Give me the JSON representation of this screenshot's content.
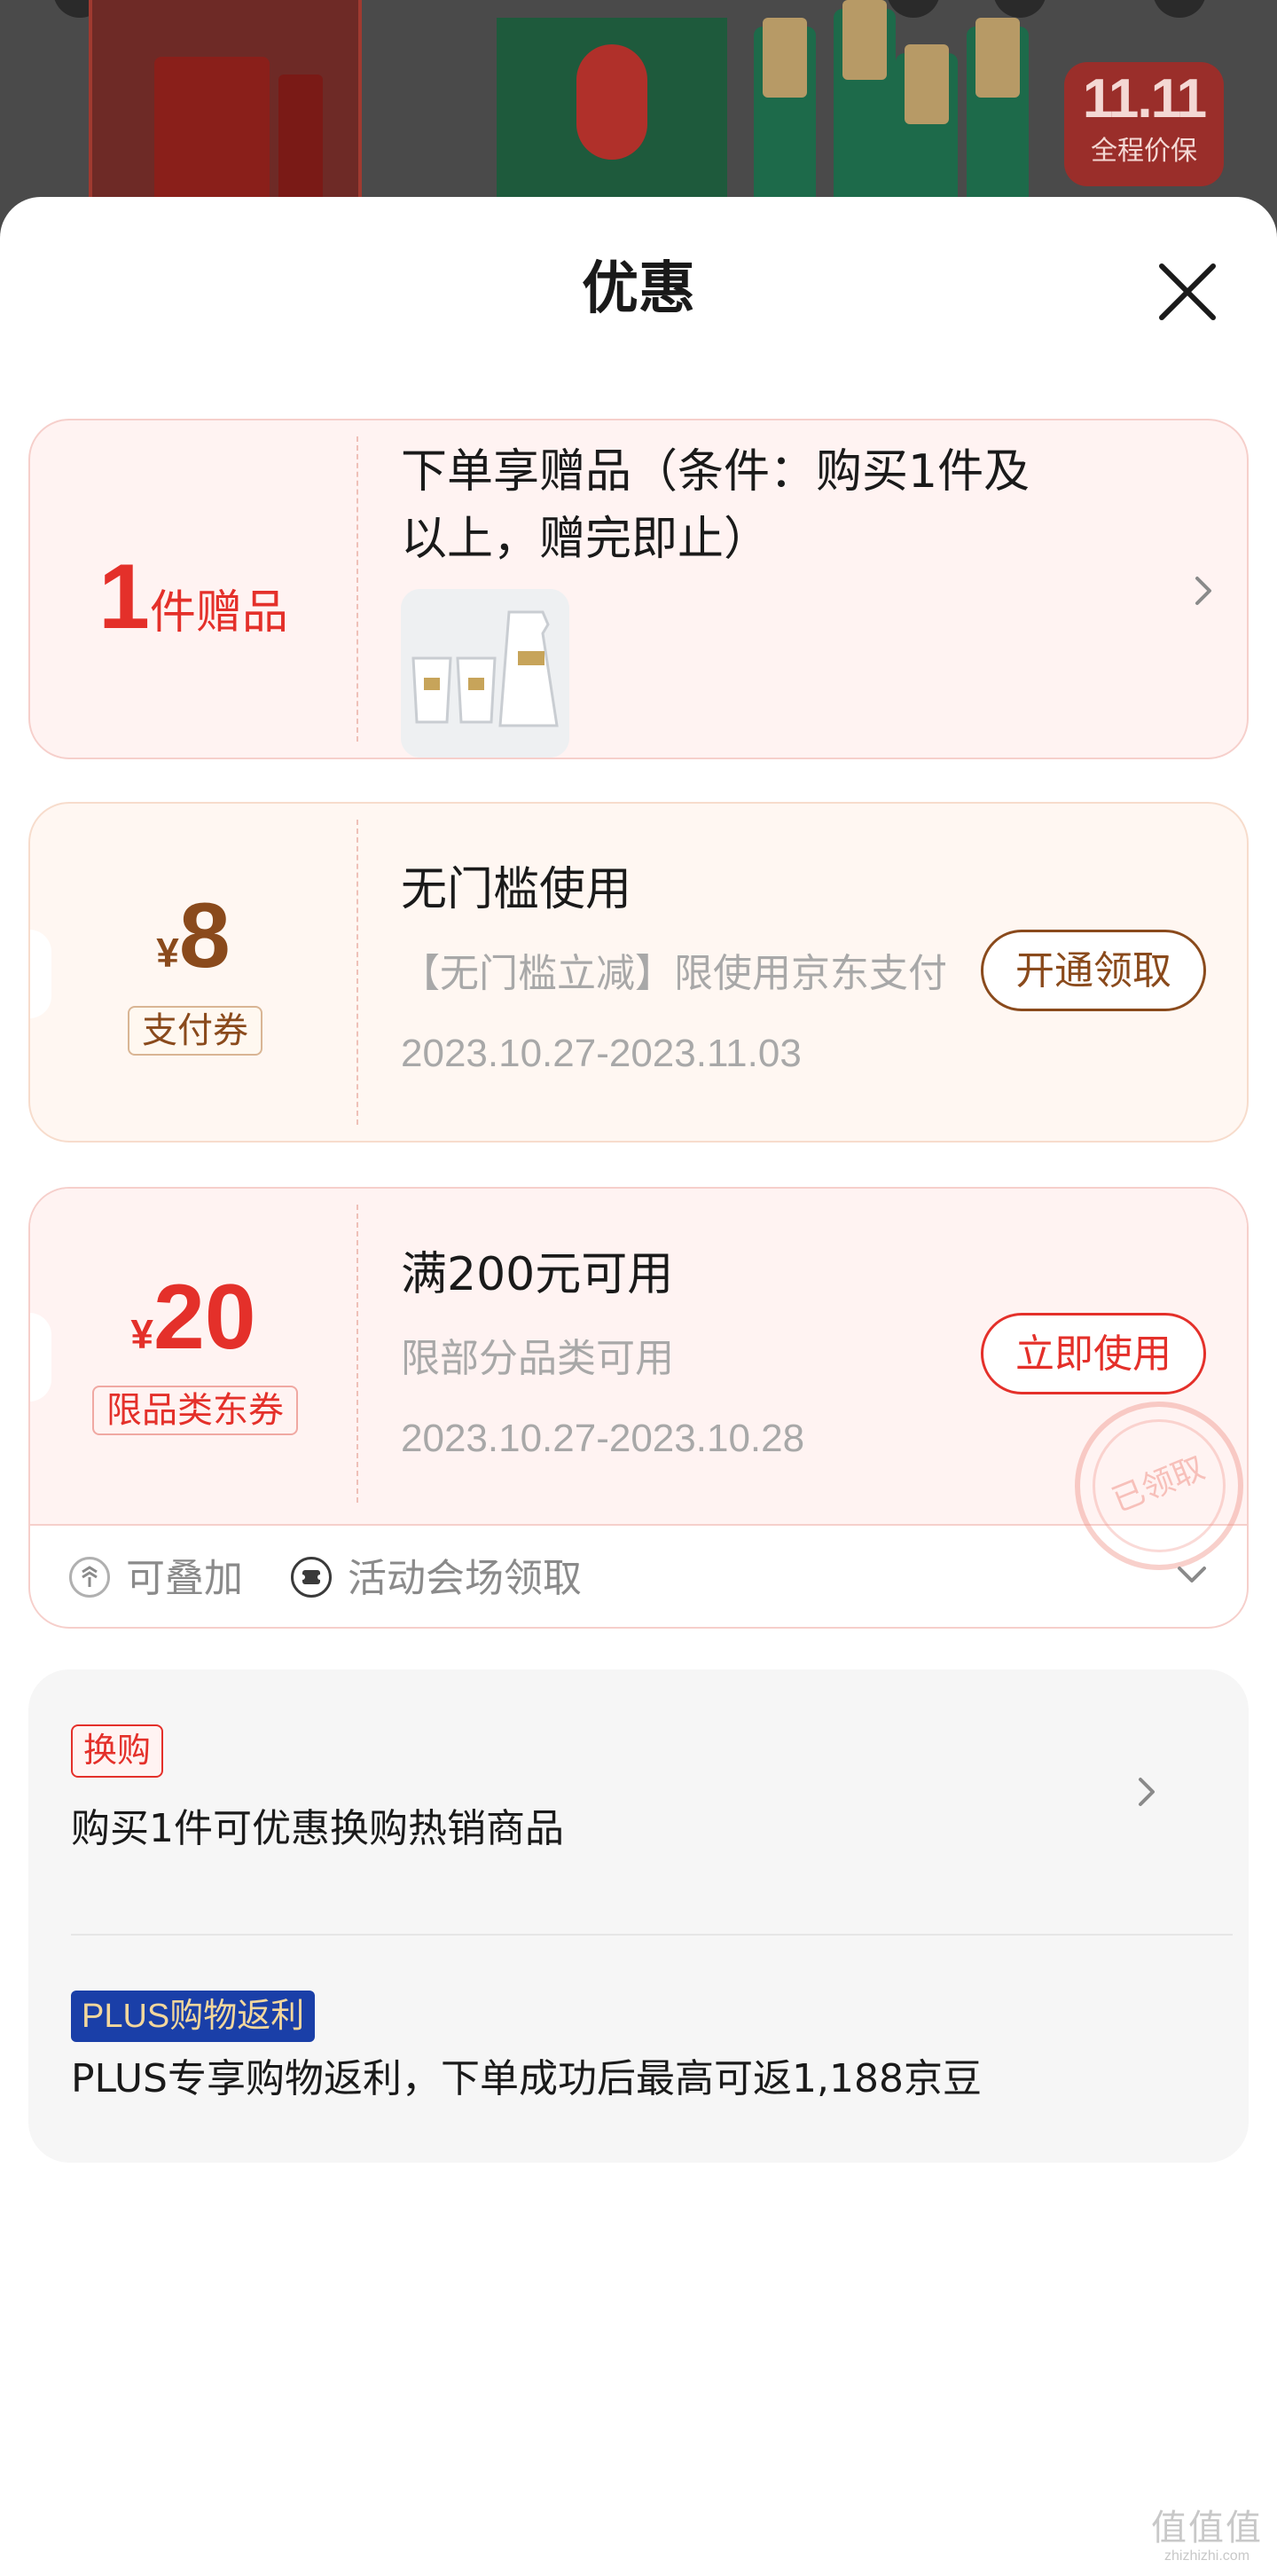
{
  "background": {
    "badge_top": "11.11",
    "badge_bottom": "全程价保"
  },
  "sheet": {
    "title": "优惠"
  },
  "gift": {
    "count": "1",
    "count_unit": "件赠品",
    "title": "下单享赠品（条件：购买1件及以上，赠完即止）"
  },
  "pay_coupon": {
    "currency": "¥",
    "amount": "8",
    "tag": "支付券",
    "title": "无门槛使用",
    "description": "【无门槛立减】限使用京东支付",
    "date": "2023.10.27-2023.11.03",
    "button": "开通领取"
  },
  "jd_coupon": {
    "currency": "¥",
    "amount": "20",
    "tag": "限品类东券",
    "title": "满200元可用",
    "description": "限部分品类可用",
    "date": "2023.10.27-2023.10.28",
    "button": "立即使用",
    "stamp": "已领取",
    "footer": {
      "stackable": "可叠加",
      "source": "活动会场领取"
    }
  },
  "exchange": {
    "tag": "换购",
    "text": "购买1件可优惠换购热销商品"
  },
  "plus": {
    "tag": "PLUS购物返利",
    "text": "PLUS专享购物返利，下单成功后最高可返1,188京豆"
  },
  "colors": {
    "primary_red": "#e4302a",
    "pay_brown": "#8a4a1c",
    "plus_blue": "#1a3fa8",
    "plus_gold": "#f3d79c"
  },
  "watermark": {
    "logo": "值值值",
    "url": "zhizhizhi.com"
  }
}
